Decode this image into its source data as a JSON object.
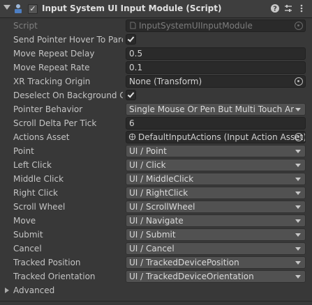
{
  "header": {
    "title": "Input System UI Input Module (Script)",
    "enabled": true
  },
  "fields": {
    "script": {
      "label": "Script",
      "value": "InputSystemUIInputModule"
    },
    "send_pointer_hover": {
      "label": "Send Pointer Hover To Parent",
      "checked": true
    },
    "move_repeat_delay": {
      "label": "Move Repeat Delay",
      "value": "0.5"
    },
    "move_repeat_rate": {
      "label": "Move Repeat Rate",
      "value": "0.1"
    },
    "xr_tracking_origin": {
      "label": "XR Tracking Origin",
      "value": "None (Transform)"
    },
    "deselect_on_background": {
      "label": "Deselect On Background Click",
      "checked": true
    },
    "pointer_behavior": {
      "label": "Pointer Behavior",
      "value": "Single Mouse Or Pen But Multi Touch And Track"
    },
    "scroll_delta": {
      "label": "Scroll Delta Per Tick",
      "value": "6"
    },
    "actions_asset": {
      "label": "Actions Asset",
      "value": "DefaultInputActions (Input Action Asset)"
    }
  },
  "actions": [
    {
      "label": "Point",
      "value": "UI / Point"
    },
    {
      "label": "Left Click",
      "value": "UI / Click"
    },
    {
      "label": "Middle Click",
      "value": "UI / MiddleClick"
    },
    {
      "label": "Right Click",
      "value": "UI / RightClick"
    },
    {
      "label": "Scroll Wheel",
      "value": "UI / ScrollWheel"
    },
    {
      "label": "Move",
      "value": "UI / Navigate"
    },
    {
      "label": "Submit",
      "value": "UI / Submit"
    },
    {
      "label": "Cancel",
      "value": "UI / Cancel"
    },
    {
      "label": "Tracked Position",
      "value": "UI / TrackedDevicePosition"
    },
    {
      "label": "Tracked Orientation",
      "value": "UI / TrackedDeviceOrientation"
    }
  ],
  "advanced": {
    "label": "Advanced"
  },
  "colors": {
    "background": "#383838",
    "field": "#2a2a2a",
    "dropdown": "#515151",
    "text": "#c4c4c4"
  },
  "icons": [
    "foldout-arrow",
    "script-component-icon",
    "help-icon",
    "preset-sliders-icon",
    "context-menu-icon",
    "object-picker-icon",
    "dropdown-arrow-icon",
    "input-action-asset-icon",
    "script-file-icon"
  ]
}
